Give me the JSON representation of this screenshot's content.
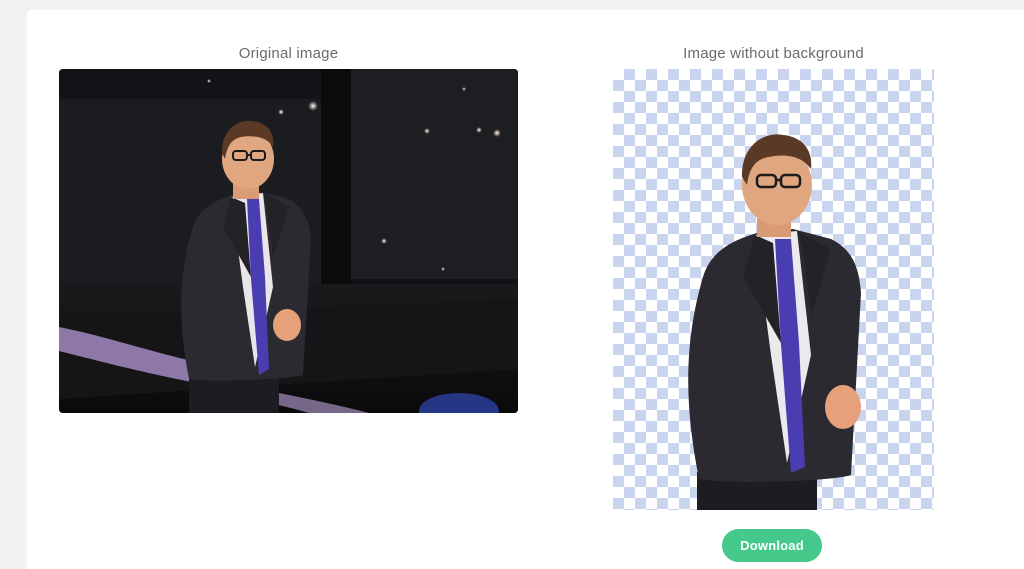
{
  "original": {
    "caption": "Original image",
    "alt_subject": "man-in-suit-on-stage"
  },
  "result": {
    "caption": "Image without background",
    "alt_subject": "man-in-suit-cutout"
  },
  "actions": {
    "download_label": "Download"
  },
  "colors": {
    "page_bg": "#f2f2f2",
    "panel_bg": "#ffffff",
    "accent_green": "#45c98a",
    "checker_blue": "#c9d4ee",
    "caption_gray": "#6b6b6b"
  }
}
